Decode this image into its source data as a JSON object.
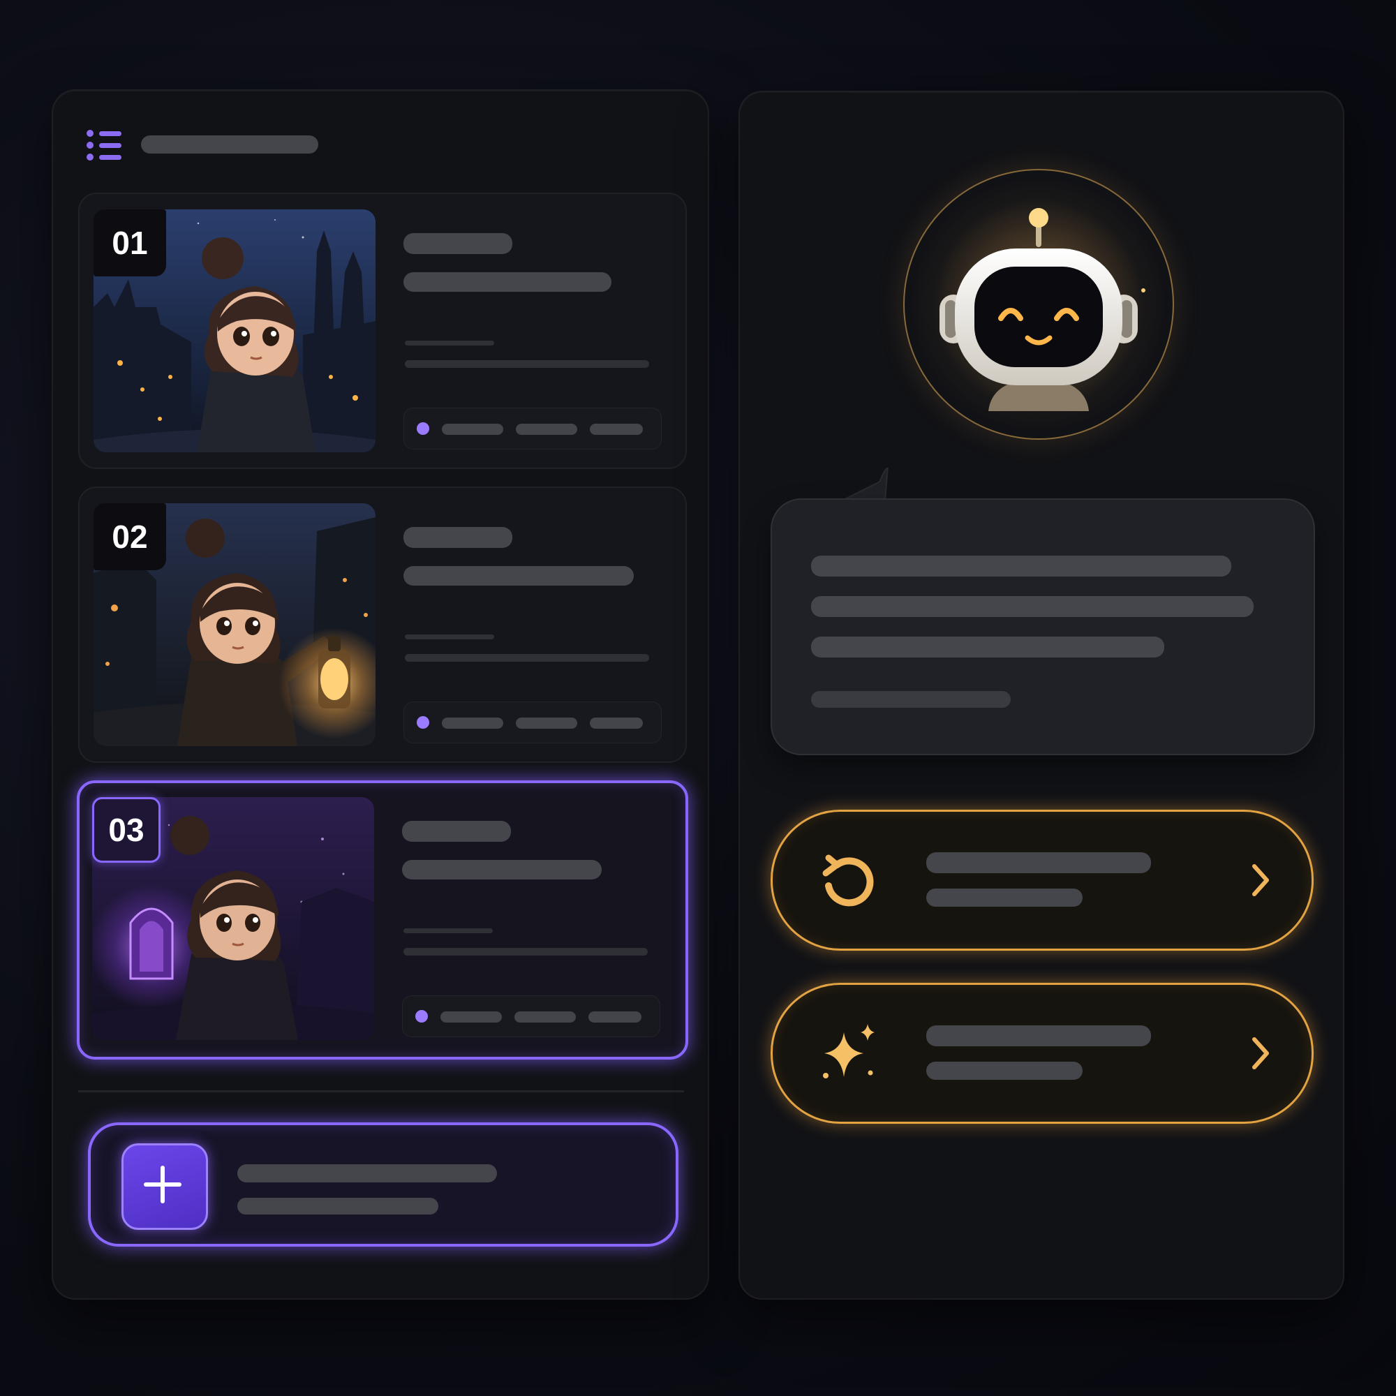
{
  "colors": {
    "accent_purple": "#8a68ff",
    "accent_gold": "#e3a343",
    "panel_bg": "#111216",
    "placeholder_bar": "#45464c"
  },
  "header": {
    "icon": "list-icon",
    "title": ""
  },
  "story_cards": [
    {
      "number": "01",
      "title": "",
      "subtitle": "",
      "scene": "girl-city-night",
      "selected": false
    },
    {
      "number": "02",
      "title": "",
      "subtitle": "",
      "scene": "girl-with-lantern",
      "selected": false
    },
    {
      "number": "03",
      "title": "",
      "subtitle": "",
      "scene": "girl-purple-portal",
      "selected": true
    }
  ],
  "create_button": {
    "icon": "plus-icon",
    "label": "",
    "sublabel": ""
  },
  "assistant": {
    "avatar": "robot-avatar",
    "message_lines": [
      "",
      "",
      "",
      ""
    ]
  },
  "actions": [
    {
      "icon": "refresh-icon",
      "label": "",
      "sublabel": "",
      "trailing_icon": "chevron-right-icon"
    },
    {
      "icon": "sparkle-icon",
      "label": "",
      "sublabel": "",
      "trailing_icon": "chevron-right-icon"
    }
  ]
}
